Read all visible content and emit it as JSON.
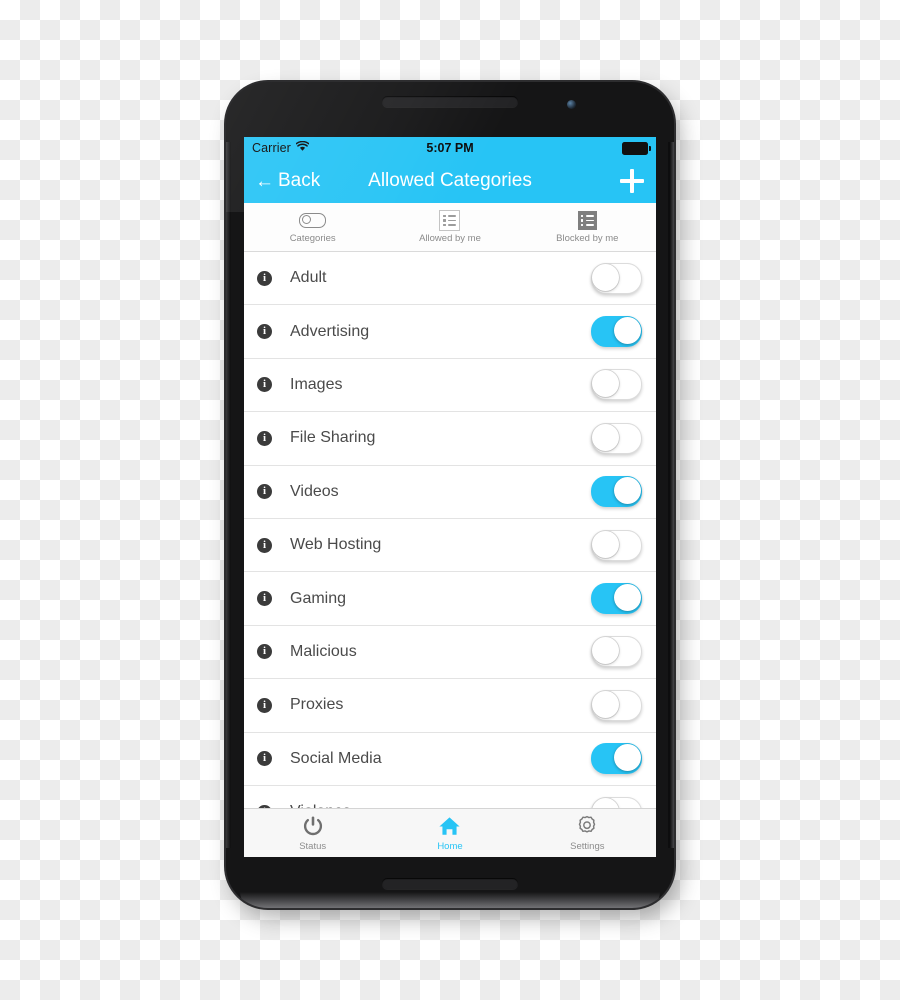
{
  "statusbar": {
    "carrier": "Carrier",
    "wifi_icon": "wifi-icon",
    "time": "5:07 PM",
    "battery_icon": "battery-full-icon"
  },
  "navbar": {
    "back_arrow": "←",
    "back_label": "Back",
    "title": "Allowed Categories",
    "add_icon": "plus-icon"
  },
  "segments": [
    {
      "label": "Categories",
      "icon": "toggle-pill-icon",
      "state": "inactive"
    },
    {
      "label": "Allowed by me",
      "icon": "list-outline-icon",
      "state": "inactive"
    },
    {
      "label": "Blocked by me",
      "icon": "list-filled-icon",
      "state": "active"
    }
  ],
  "list": {
    "info_glyph": "i",
    "rows": [
      {
        "label": "Adult",
        "enabled": false
      },
      {
        "label": "Advertising",
        "enabled": true
      },
      {
        "label": "Images",
        "enabled": false
      },
      {
        "label": "File Sharing",
        "enabled": false
      },
      {
        "label": "Videos",
        "enabled": true
      },
      {
        "label": "Web Hosting",
        "enabled": false
      },
      {
        "label": "Gaming",
        "enabled": true
      },
      {
        "label": "Malicious",
        "enabled": false
      },
      {
        "label": "Proxies",
        "enabled": false
      },
      {
        "label": "Social Media",
        "enabled": true
      },
      {
        "label": "Violence",
        "enabled": false
      }
    ]
  },
  "tabbar": {
    "tabs": [
      {
        "label": "Status",
        "icon": "power-icon",
        "active": false
      },
      {
        "label": "Home",
        "icon": "home-icon",
        "active": true
      },
      {
        "label": "Settings",
        "icon": "gear-icon",
        "active": false
      }
    ]
  },
  "colors": {
    "accent": "#27C4F5",
    "toggle_on": "#27C4F5",
    "text_primary": "#4a4a4a",
    "text_muted": "#8b8b8b",
    "device_body": "#151516"
  }
}
